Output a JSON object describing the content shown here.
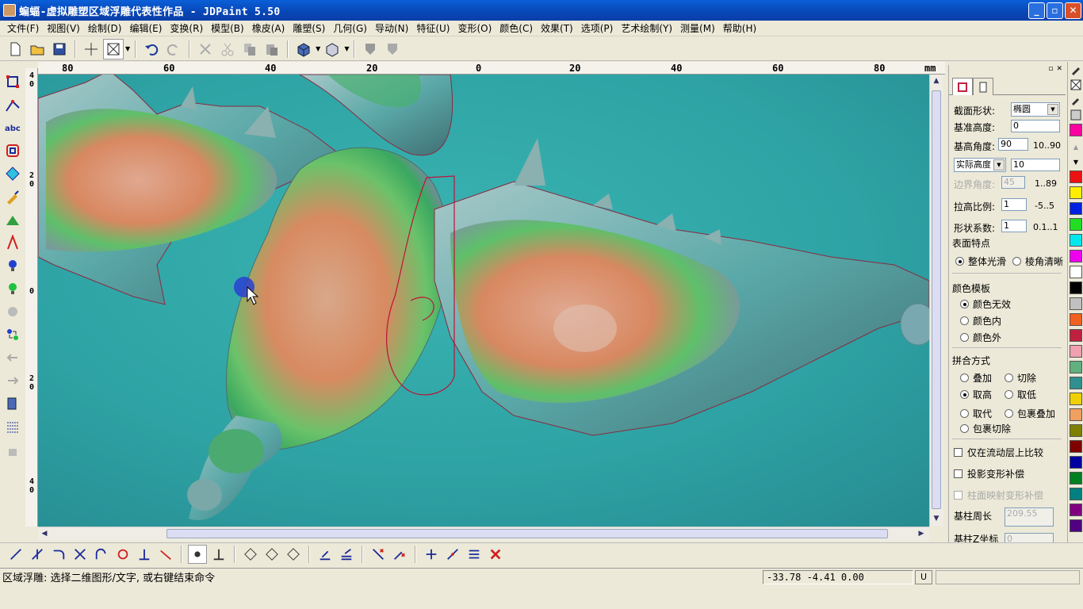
{
  "window": {
    "title": "蝙蝠-虚拟雕塑区域浮雕代表性作品 - JDPaint 5.50"
  },
  "menu": [
    "文件(F)",
    "视图(V)",
    "绘制(D)",
    "编辑(E)",
    "变换(R)",
    "模型(B)",
    "橡皮(A)",
    "雕塑(S)",
    "几何(G)",
    "导动(N)",
    "特征(U)",
    "变形(O)",
    "颜色(C)",
    "效果(T)",
    "选项(P)",
    "艺术绘制(Y)",
    "测量(M)",
    "帮助(H)"
  ],
  "ruler": {
    "h_ticks": [
      "80",
      "60",
      "40",
      "20",
      "0",
      "20",
      "40",
      "60",
      "80"
    ],
    "unit": "mm",
    "v_ticks": [
      "4\n0",
      "2\n0",
      "0",
      "2\n0",
      "4\n0"
    ]
  },
  "status": {
    "message": "区域浮雕: 选择二维图形/文字, 或右键结束命令",
    "coords": "-33.78 -4.41 0.00",
    "mode": "U"
  },
  "panel": {
    "section_shape": {
      "label": "截面形状:",
      "value": "椭圆"
    },
    "base_height": {
      "label": "基准高度:",
      "value": "0"
    },
    "base_angle": {
      "label": "基高角度:",
      "value": "90",
      "range": "10..90"
    },
    "height_mode": {
      "value": "实际高度",
      "height": "10"
    },
    "edge_angle": {
      "label": "边界角度:",
      "value": "45",
      "range": "1..89"
    },
    "height_ratio": {
      "label": "拉高比例:",
      "value": "1",
      "range": "-5..5"
    },
    "shape_coef": {
      "label": "形状系数:",
      "value": "1",
      "range": "0.1..1"
    },
    "surface": {
      "label": "表面特点",
      "smooth": "整体光滑",
      "sharp": "棱角清晰"
    },
    "color_template": {
      "label": "颜色模板",
      "none": "颜色无效",
      "inner": "颜色内",
      "outer": "颜色外"
    },
    "merge": {
      "label": "拼合方式",
      "add": "叠加",
      "cut": "切除",
      "high": "取高",
      "low": "取低",
      "replace": "取代",
      "wrap_add": "包裹叠加",
      "wrap_cut": "包裹切除"
    },
    "checks": {
      "flow_compare": "仅在流动层上比较",
      "proj_comp": "投影变形补偿",
      "cyl_map": "柱面映射变形补偿"
    },
    "cyl_perimeter": {
      "label": "基柱周长",
      "value": "209.55"
    },
    "cyl_z": {
      "label": "基柱Z坐标",
      "value": "0"
    }
  },
  "palette": [
    "#ff00a0",
    "#ee1111",
    "#ffee00",
    "#0020e0",
    "#22dd22",
    "#00e8ee",
    "#ee00ee",
    "#ffffff",
    "#000000",
    "#c0c0c0",
    "#f06020",
    "#c02040",
    "#f0a0b0",
    "#60b080",
    "#309090",
    "#f0d000",
    "#f0a060",
    "#808000",
    "#800000",
    "#0000a0",
    "#008020",
    "#008080",
    "#800080",
    "#500080"
  ],
  "scene": {
    "bg": "#2fa4a6",
    "relief_outline": "#c0103a"
  }
}
